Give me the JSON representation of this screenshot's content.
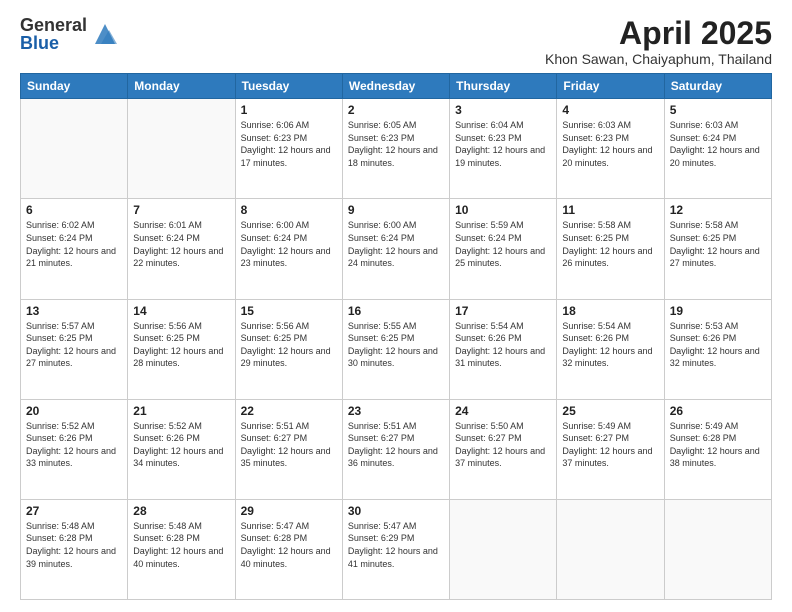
{
  "logo": {
    "general": "General",
    "blue": "Blue"
  },
  "title": "April 2025",
  "location": "Khon Sawan, Chaiyaphum, Thailand",
  "days_of_week": [
    "Sunday",
    "Monday",
    "Tuesday",
    "Wednesday",
    "Thursday",
    "Friday",
    "Saturday"
  ],
  "weeks": [
    [
      {
        "day": "",
        "info": ""
      },
      {
        "day": "",
        "info": ""
      },
      {
        "day": "1",
        "info": "Sunrise: 6:06 AM\nSunset: 6:23 PM\nDaylight: 12 hours and 17 minutes."
      },
      {
        "day": "2",
        "info": "Sunrise: 6:05 AM\nSunset: 6:23 PM\nDaylight: 12 hours and 18 minutes."
      },
      {
        "day": "3",
        "info": "Sunrise: 6:04 AM\nSunset: 6:23 PM\nDaylight: 12 hours and 19 minutes."
      },
      {
        "day": "4",
        "info": "Sunrise: 6:03 AM\nSunset: 6:23 PM\nDaylight: 12 hours and 20 minutes."
      },
      {
        "day": "5",
        "info": "Sunrise: 6:03 AM\nSunset: 6:24 PM\nDaylight: 12 hours and 20 minutes."
      }
    ],
    [
      {
        "day": "6",
        "info": "Sunrise: 6:02 AM\nSunset: 6:24 PM\nDaylight: 12 hours and 21 minutes."
      },
      {
        "day": "7",
        "info": "Sunrise: 6:01 AM\nSunset: 6:24 PM\nDaylight: 12 hours and 22 minutes."
      },
      {
        "day": "8",
        "info": "Sunrise: 6:00 AM\nSunset: 6:24 PM\nDaylight: 12 hours and 23 minutes."
      },
      {
        "day": "9",
        "info": "Sunrise: 6:00 AM\nSunset: 6:24 PM\nDaylight: 12 hours and 24 minutes."
      },
      {
        "day": "10",
        "info": "Sunrise: 5:59 AM\nSunset: 6:24 PM\nDaylight: 12 hours and 25 minutes."
      },
      {
        "day": "11",
        "info": "Sunrise: 5:58 AM\nSunset: 6:25 PM\nDaylight: 12 hours and 26 minutes."
      },
      {
        "day": "12",
        "info": "Sunrise: 5:58 AM\nSunset: 6:25 PM\nDaylight: 12 hours and 27 minutes."
      }
    ],
    [
      {
        "day": "13",
        "info": "Sunrise: 5:57 AM\nSunset: 6:25 PM\nDaylight: 12 hours and 27 minutes."
      },
      {
        "day": "14",
        "info": "Sunrise: 5:56 AM\nSunset: 6:25 PM\nDaylight: 12 hours and 28 minutes."
      },
      {
        "day": "15",
        "info": "Sunrise: 5:56 AM\nSunset: 6:25 PM\nDaylight: 12 hours and 29 minutes."
      },
      {
        "day": "16",
        "info": "Sunrise: 5:55 AM\nSunset: 6:25 PM\nDaylight: 12 hours and 30 minutes."
      },
      {
        "day": "17",
        "info": "Sunrise: 5:54 AM\nSunset: 6:26 PM\nDaylight: 12 hours and 31 minutes."
      },
      {
        "day": "18",
        "info": "Sunrise: 5:54 AM\nSunset: 6:26 PM\nDaylight: 12 hours and 32 minutes."
      },
      {
        "day": "19",
        "info": "Sunrise: 5:53 AM\nSunset: 6:26 PM\nDaylight: 12 hours and 32 minutes."
      }
    ],
    [
      {
        "day": "20",
        "info": "Sunrise: 5:52 AM\nSunset: 6:26 PM\nDaylight: 12 hours and 33 minutes."
      },
      {
        "day": "21",
        "info": "Sunrise: 5:52 AM\nSunset: 6:26 PM\nDaylight: 12 hours and 34 minutes."
      },
      {
        "day": "22",
        "info": "Sunrise: 5:51 AM\nSunset: 6:27 PM\nDaylight: 12 hours and 35 minutes."
      },
      {
        "day": "23",
        "info": "Sunrise: 5:51 AM\nSunset: 6:27 PM\nDaylight: 12 hours and 36 minutes."
      },
      {
        "day": "24",
        "info": "Sunrise: 5:50 AM\nSunset: 6:27 PM\nDaylight: 12 hours and 37 minutes."
      },
      {
        "day": "25",
        "info": "Sunrise: 5:49 AM\nSunset: 6:27 PM\nDaylight: 12 hours and 37 minutes."
      },
      {
        "day": "26",
        "info": "Sunrise: 5:49 AM\nSunset: 6:28 PM\nDaylight: 12 hours and 38 minutes."
      }
    ],
    [
      {
        "day": "27",
        "info": "Sunrise: 5:48 AM\nSunset: 6:28 PM\nDaylight: 12 hours and 39 minutes."
      },
      {
        "day": "28",
        "info": "Sunrise: 5:48 AM\nSunset: 6:28 PM\nDaylight: 12 hours and 40 minutes."
      },
      {
        "day": "29",
        "info": "Sunrise: 5:47 AM\nSunset: 6:28 PM\nDaylight: 12 hours and 40 minutes."
      },
      {
        "day": "30",
        "info": "Sunrise: 5:47 AM\nSunset: 6:29 PM\nDaylight: 12 hours and 41 minutes."
      },
      {
        "day": "",
        "info": ""
      },
      {
        "day": "",
        "info": ""
      },
      {
        "day": "",
        "info": ""
      }
    ]
  ]
}
